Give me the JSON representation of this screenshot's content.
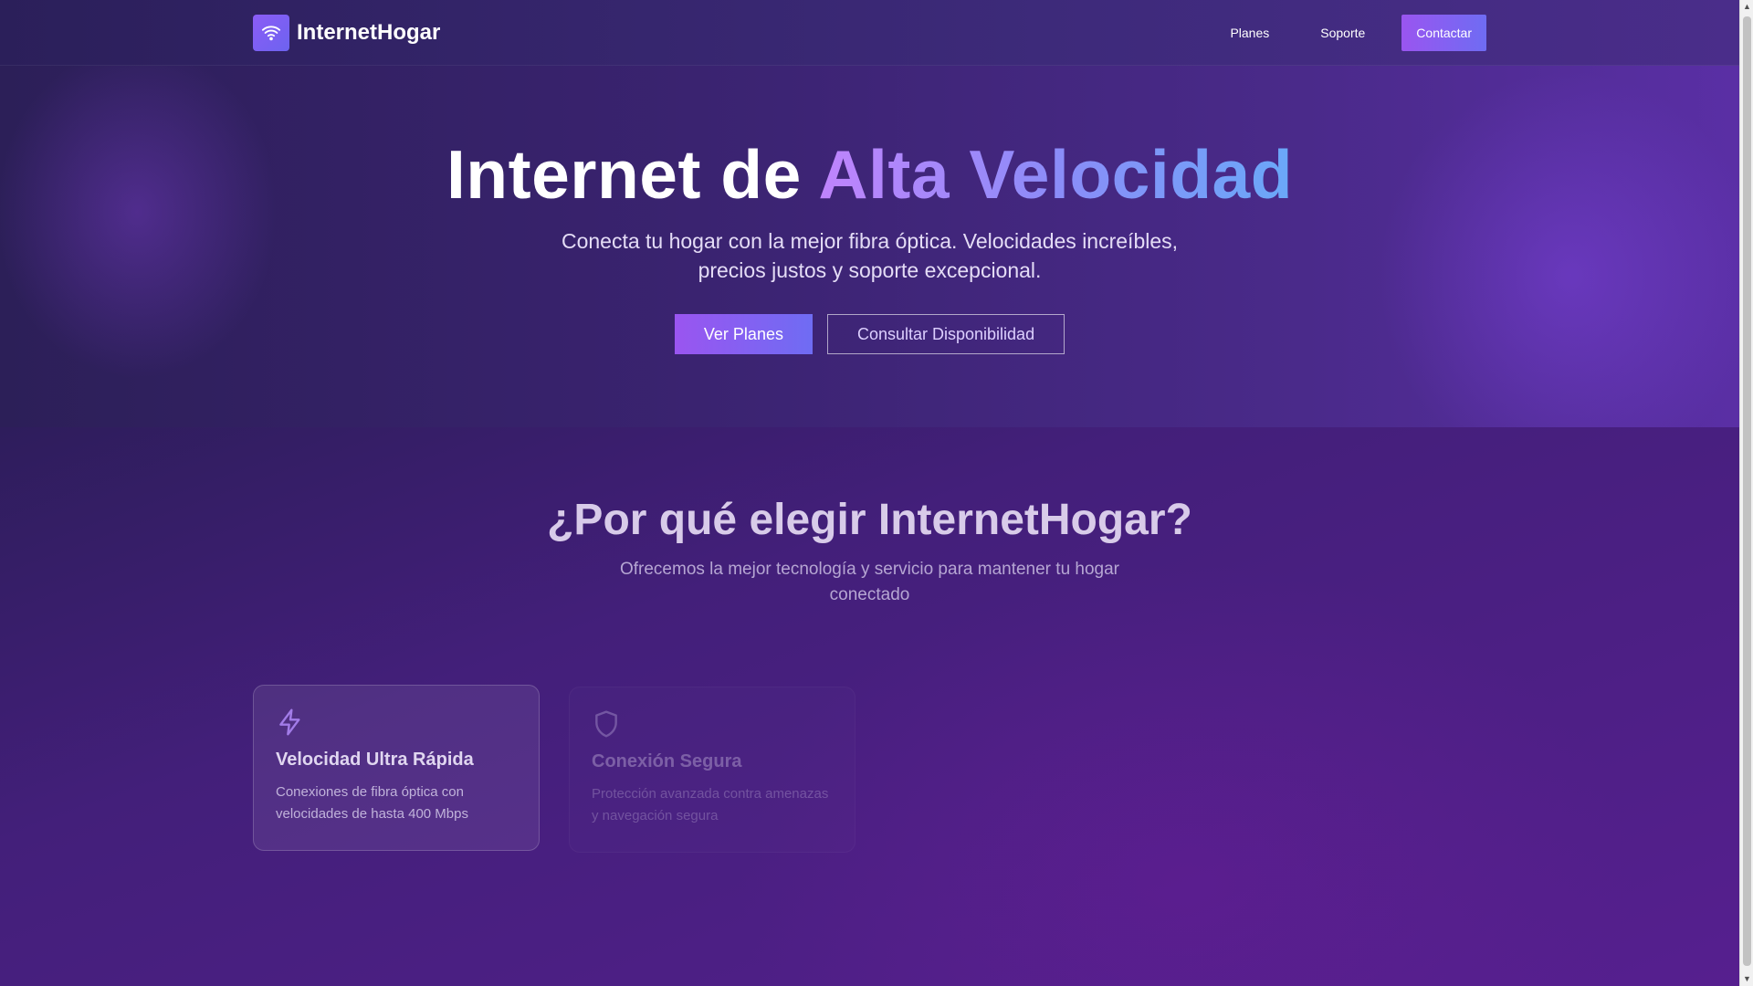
{
  "header": {
    "brand": "InternetHogar",
    "nav": [
      {
        "label": "Planes"
      },
      {
        "label": "Soporte"
      }
    ],
    "cta": "Contactar"
  },
  "hero": {
    "title_prefix": "Internet de ",
    "title_accent": "Alta Velocidad",
    "subtitle": "Conecta tu hogar con la mejor fibra óptica. Velocidades increíbles, precios justos y soporte excepcional.",
    "primary_button": "Ver Planes",
    "secondary_button": "Consultar Disponibilidad"
  },
  "features": {
    "title": "¿Por qué elegir InternetHogar?",
    "subtitle": "Ofrecemos la mejor tecnología y servicio para mantener tu hogar conectado",
    "cards": [
      {
        "icon": "lightning-icon",
        "title": "Velocidad Ultra Rápida",
        "text": "Conexiones de fibra óptica con velocidades de hasta 400 Mbps"
      },
      {
        "icon": "shield-icon",
        "title": "Conexión Segura",
        "text": "Protección avanzada contra amenazas y navegación segura"
      }
    ]
  },
  "colors": {
    "accent_start": "#9a55f0",
    "accent_end": "#6f6cf3",
    "background_dark": "#2c1f58",
    "background_purple": "#561f8f"
  }
}
